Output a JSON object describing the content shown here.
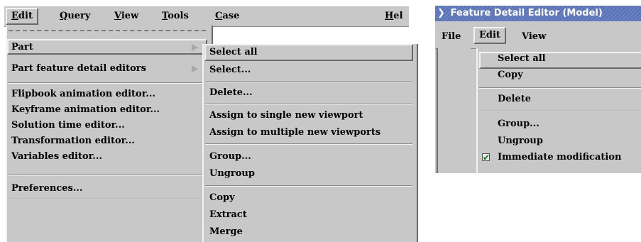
{
  "left": {
    "menubar": [
      {
        "label": "Edit",
        "underline": "E"
      },
      {
        "label": "Query",
        "underline": "Q"
      },
      {
        "label": "View",
        "underline": "V"
      },
      {
        "label": "Tools",
        "underline": "T"
      },
      {
        "label": "Case",
        "underline": "C"
      },
      {
        "label": "Hel",
        "underline": "H"
      }
    ],
    "edit_menu": [
      {
        "label": "Part",
        "submenu": true
      },
      {
        "label": "Part feature detail editors",
        "submenu": true
      },
      {
        "label": "Flipbook animation editor..."
      },
      {
        "label": "Keyframe animation editor..."
      },
      {
        "label": "Solution time editor..."
      },
      {
        "label": "Transformation editor..."
      },
      {
        "label": "Variables editor..."
      },
      {
        "label": "Preferences..."
      }
    ],
    "part_submenu": [
      "Select all",
      "Select...",
      "Delete...",
      "Assign to single new viewport",
      "Assign to multiple new viewports",
      "Group...",
      "Ungroup",
      "Copy",
      "Extract",
      "Merge"
    ]
  },
  "right": {
    "title": "Feature Detail Editor (Model)",
    "menubar": [
      "File",
      "Edit",
      "View"
    ],
    "edit_menu": [
      "Select all",
      "Copy",
      "Delete",
      "Group...",
      "Ungroup",
      "Immediate modification"
    ],
    "immediate_modification_checked": true
  },
  "colors": {
    "menu_bg": "#c8c8c8",
    "title_bg": "#6a82c4",
    "check_mark": "#008000"
  }
}
